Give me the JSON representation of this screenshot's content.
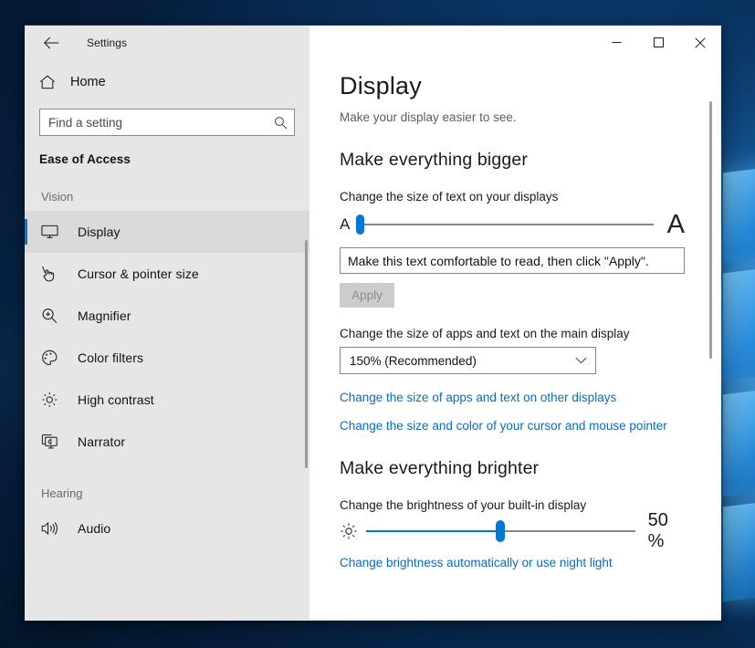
{
  "window": {
    "app_title": "Settings",
    "back_icon": "back-arrow-icon",
    "controls": {
      "minimize": "minimize-icon",
      "maximize": "maximize-icon",
      "close": "close-icon"
    }
  },
  "sidebar": {
    "home": {
      "label": "Home",
      "icon": "home-icon"
    },
    "search": {
      "placeholder": "Find a setting",
      "value": "",
      "icon": "search-icon"
    },
    "category": "Ease of Access",
    "groups": [
      {
        "label": "Vision",
        "items": [
          {
            "label": "Display",
            "icon": "monitor-icon",
            "selected": true
          },
          {
            "label": "Cursor & pointer size",
            "icon": "cursor-pointer-icon",
            "selected": false
          },
          {
            "label": "Magnifier",
            "icon": "magnifier-icon",
            "selected": false
          },
          {
            "label": "Color filters",
            "icon": "color-palette-icon",
            "selected": false
          },
          {
            "label": "High contrast",
            "icon": "brightness-icon",
            "selected": false
          },
          {
            "label": "Narrator",
            "icon": "narrator-icon",
            "selected": false
          }
        ]
      },
      {
        "label": "Hearing",
        "items": [
          {
            "label": "Audio",
            "icon": "speaker-icon",
            "selected": false
          }
        ]
      }
    ]
  },
  "main": {
    "title": "Display",
    "subtitle": "Make your display easier to see.",
    "sections": [
      {
        "heading": "Make everything bigger",
        "text_size": {
          "label": "Change the size of text on your displays",
          "small_a": "A",
          "large_a": "A",
          "slider_percent": 0,
          "sample_text": "Make this text comfortable to read, then click \"Apply\".",
          "apply_label": "Apply",
          "apply_disabled": true
        },
        "scale": {
          "label": "Change the size of apps and text on the main display",
          "selected_option": "150% (Recommended)",
          "chevron_icon": "chevron-down-icon"
        },
        "links": [
          "Change the size of apps and text on other displays",
          "Change the size and color of your cursor and mouse pointer"
        ]
      },
      {
        "heading": "Make everything brighter",
        "brightness": {
          "label": "Change the brightness of your built-in display",
          "icon": "sun-icon",
          "value_percent": 50,
          "value_text": "50 %",
          "link": "Change brightness automatically or use night light"
        }
      }
    ]
  },
  "colors": {
    "accent": "#0078d7",
    "link": "#0a6cbf",
    "sidebar_bg": "#e6e6e6",
    "selected_bg": "#dadada"
  }
}
